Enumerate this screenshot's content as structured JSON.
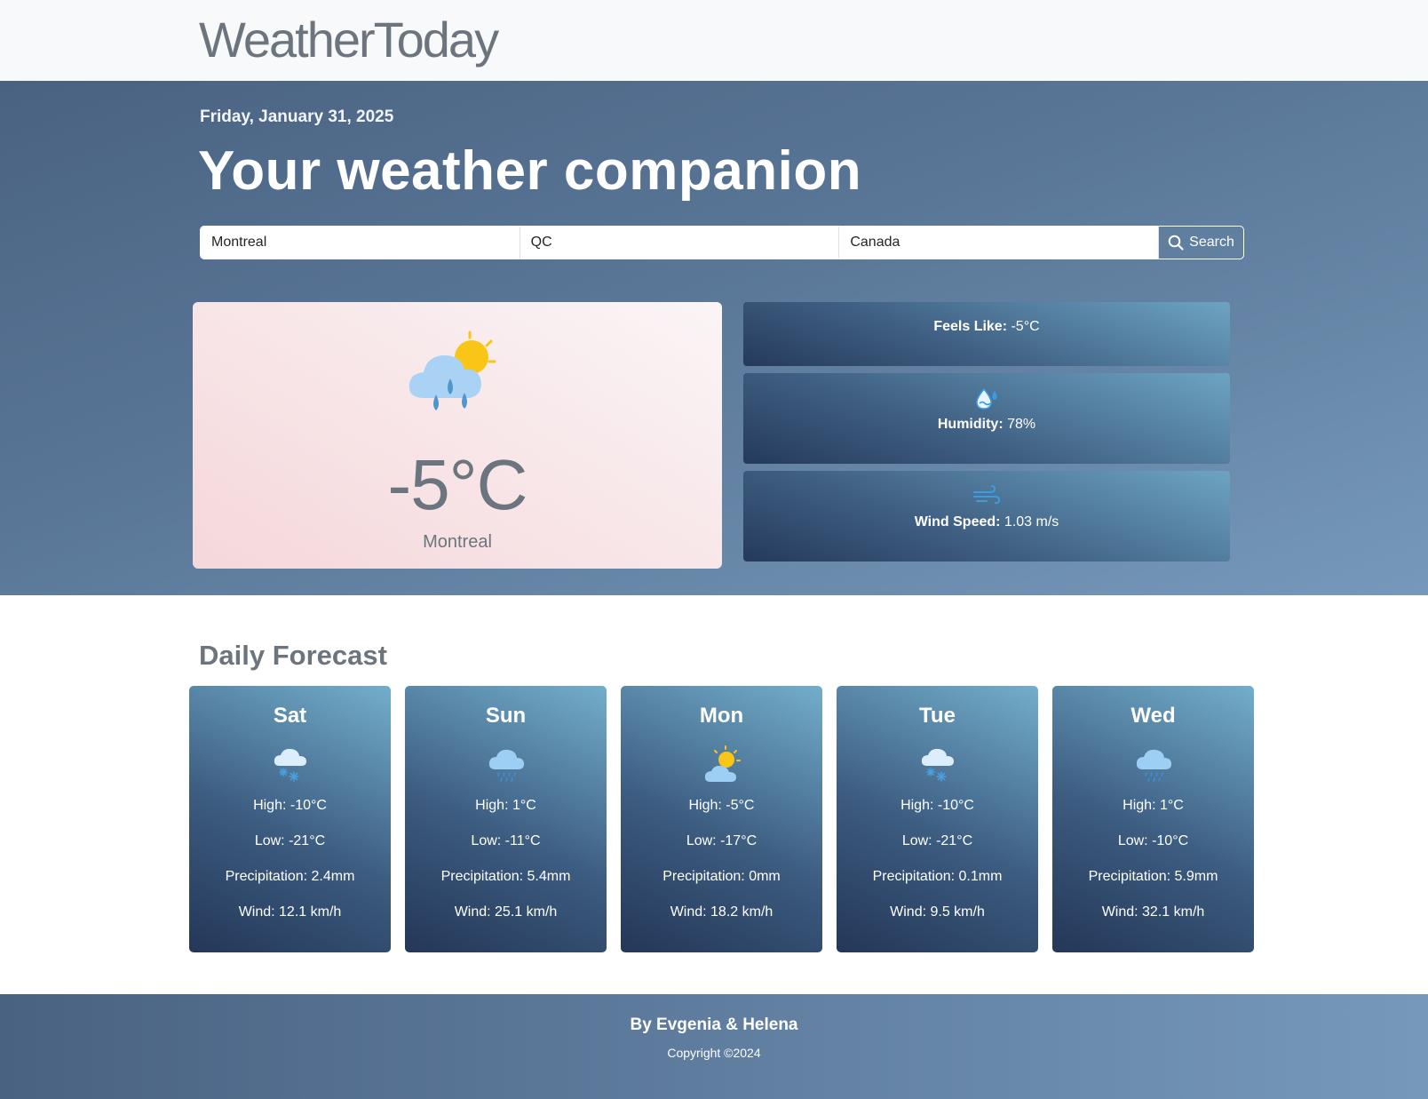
{
  "navbar": {
    "brand": "WeatherToday"
  },
  "hero": {
    "date": "Friday, January 31, 2025",
    "headline": "Your weather companion"
  },
  "search": {
    "city": "Montreal",
    "region": "QC",
    "country": "Canada",
    "button_label": "Search",
    "button_icon": "search-icon"
  },
  "current": {
    "icon": "rain-sun-cloud-icon",
    "temperature": "-5°C",
    "city": "Montreal",
    "feels_like_label": "Feels Like:",
    "feels_like_value": " -5°C",
    "humidity_icon": "humidity-icon",
    "humidity_label": "Humidity:",
    "humidity_value": " 78%",
    "wind_icon": "wind-icon",
    "wind_label": "Wind Speed:",
    "wind_value": " 1.03 m/s"
  },
  "forecast": {
    "title": "Daily Forecast",
    "days": [
      {
        "day": "Sat",
        "icon": "snow-cloud-icon",
        "high": "High: -10°C",
        "low": "Low: -21°C",
        "precip": "Precipitation: 2.4mm",
        "wind": "Wind: 12.1 km/h"
      },
      {
        "day": "Sun",
        "icon": "rain-cloud-icon",
        "high": "High: 1°C",
        "low": "Low: -11°C",
        "precip": "Precipitation: 5.4mm",
        "wind": "Wind: 25.1 km/h"
      },
      {
        "day": "Mon",
        "icon": "partly-cloudy-icon",
        "high": "High: -5°C",
        "low": "Low: -17°C",
        "precip": "Precipitation: 0mm",
        "wind": "Wind: 18.2 km/h"
      },
      {
        "day": "Tue",
        "icon": "snow-cloud-icon",
        "high": "High: -10°C",
        "low": "Low: -21°C",
        "precip": "Precipitation: 0.1mm",
        "wind": "Wind: 9.5 km/h"
      },
      {
        "day": "Wed",
        "icon": "rain-cloud-icon",
        "high": "High: 1°C",
        "low": "Low: -10°C",
        "precip": "Precipitation: 5.9mm",
        "wind": "Wind: 32.1 km/h"
      }
    ]
  },
  "footer": {
    "by": "By Evgenia & Helena",
    "copyright": "Copyright ©2024"
  }
}
